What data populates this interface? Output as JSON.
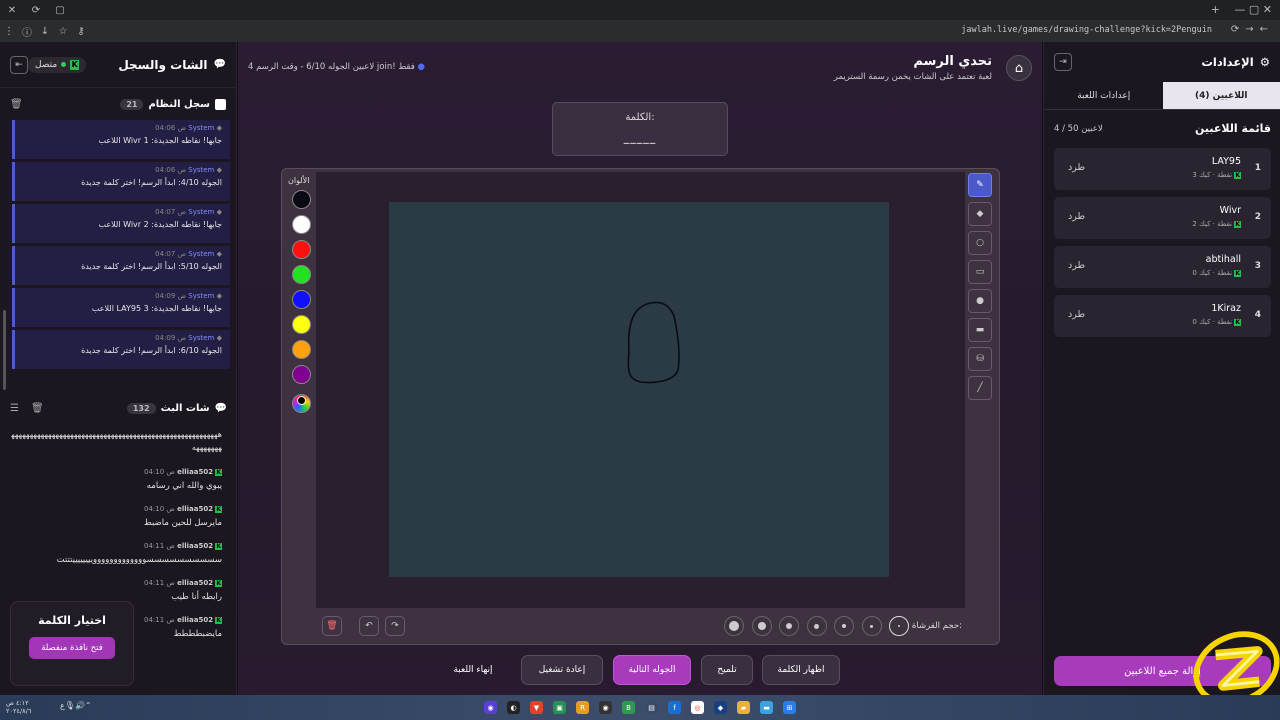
{
  "browser": {
    "url": "jawlah.live/games/drawing-challenge?kick=2Penguin"
  },
  "left_panel": {
    "title": "الشات والسجل",
    "status": "متصل",
    "system_log": {
      "title": "سجل النظام",
      "count": "21",
      "messages": [
        {
          "author": "System",
          "time": "04:06 ص",
          "text": "اللاعب Wivr جابها! نقاطه الجديدة: 1"
        },
        {
          "author": "System",
          "time": "04:06 ص",
          "text": "الجوله 4/10: ابدأ الرسم! اختر كلمة جديدة"
        },
        {
          "author": "System",
          "time": "04:07 ص",
          "text": "اللاعب Wivr جابها! نقاطه الجديدة: 2"
        },
        {
          "author": "System",
          "time": "04:07 ص",
          "text": "الجوله 5/10: ابدأ الرسم! اختر كلمة جديدة"
        },
        {
          "author": "System",
          "time": "04:09 ص",
          "text": "اللاعب LAY95 جابها! نقاطه الجديدة: 3"
        },
        {
          "author": "System",
          "time": "04:09 ص",
          "text": "الجوله 6/10: ابدأ الرسم! اختر كلمة جديدة"
        }
      ]
    },
    "stream_chat": {
      "title": "شات البث",
      "count": "132",
      "long_message": "ههههههههههههههههههههههههههههههههههههههههههههههههههههههههههههههههه",
      "messages": [
        {
          "user": "elliaa502",
          "time": "04:10 ص",
          "text": "يبوي والله اني رسامه"
        },
        {
          "user": "elliaa502",
          "time": "04:10 ص",
          "text": "مايرسل للحين ماضبط"
        },
        {
          "user": "elliaa502",
          "time": "04:11 ص",
          "text": "سسسسسسسسسسوووووووووووووييييييييتتتت"
        },
        {
          "user": "elliaa502",
          "time": "04:11 ص",
          "text": "رابطه أنا طيب"
        },
        {
          "user": "elliaa502",
          "time": "04:11 ص",
          "text": "مايضبطططط"
        }
      ]
    },
    "popup": {
      "title": "اختيار الكلمة",
      "button": "فتح نافذة منفصلة"
    }
  },
  "center": {
    "title": "تحدي الرسم",
    "subtitle": "لعبة تعتمد على الشات يخمن رسمة الستريمر",
    "info": "4 لاعبين   الجوله 6/10 - وقت الرسم   join! فقط",
    "word_label": "الكلمة:",
    "word_blank": "_____",
    "colors_label": "الألوان",
    "colors": [
      "#0a0a14",
      "#ffffff",
      "#ff1010",
      "#22e022",
      "#1010ff",
      "#ffff10",
      "#ffa010",
      "#800090"
    ],
    "brush_label": "حجم الفرشاة:",
    "controls": {
      "reveal": "اظهار الكلمة",
      "hint": "تلميح",
      "next": "الجوله التالية",
      "restart": "إعادة تشغيل",
      "end": "إنهاء اللعبة"
    }
  },
  "right_panel": {
    "title": "الإعدادات",
    "tabs": [
      "اللاعبين (4)",
      "إعدادات اللعبة"
    ],
    "players_title": "قائمة اللاعبين",
    "players_count": "4 / 50 لاعبين",
    "players": [
      {
        "rank": "1",
        "name": "LAY95",
        "platform": "كيك",
        "points": "3 نقطة",
        "kick": "طرد"
      },
      {
        "rank": "2",
        "name": "Wivr",
        "platform": "كيك",
        "points": "2 نقطة",
        "kick": "طرد"
      },
      {
        "rank": "3",
        "name": "abtihall",
        "platform": "كيك",
        "points": "0 نقطة",
        "kick": "طرد"
      },
      {
        "rank": "4",
        "name": "1Kiraz",
        "platform": "كيك",
        "points": "0 نقطة",
        "kick": "طرد"
      }
    ],
    "remove_all": "إزالة جميع اللاعبين"
  },
  "taskbar": {
    "time": "٤:١٢ ص",
    "date": "٢٠٢٤/٨/٦"
  }
}
